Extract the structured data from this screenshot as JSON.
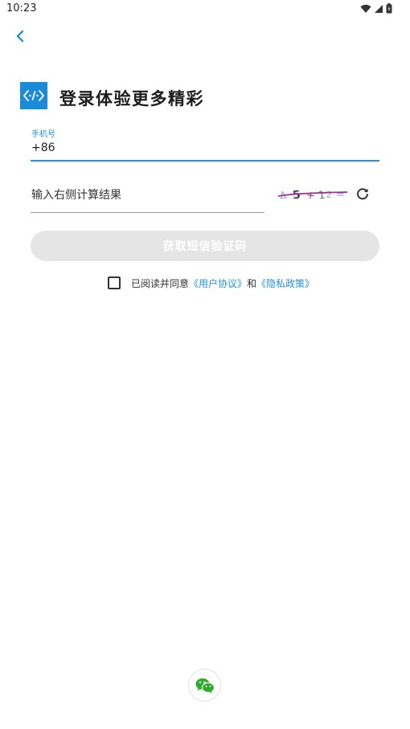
{
  "status_bar": {
    "time": "10:23"
  },
  "header": {
    "title": "登录体验更多精彩"
  },
  "phone": {
    "label": "手机号",
    "value": "+86"
  },
  "captcha": {
    "placeholder": "输入右侧计算结果"
  },
  "sms_button": {
    "label": "获取短信验证码"
  },
  "agreement": {
    "prefix": "已阅读并同意",
    "user_agreement": "《用户协议》",
    "connector": "和",
    "privacy_policy": "《隐私政策》"
  },
  "colors": {
    "accent": "#2592d6",
    "logo_bg": "#1a8bd9",
    "button_disabled_bg": "#e5e5e6",
    "wechat_green": "#2aae2a"
  },
  "icons": {
    "back": "chevron-left-icon",
    "refresh": "refresh-icon",
    "wechat": "wechat-icon",
    "wifi": "wifi-icon",
    "signal": "signal-icon",
    "battery": "battery-icon"
  }
}
